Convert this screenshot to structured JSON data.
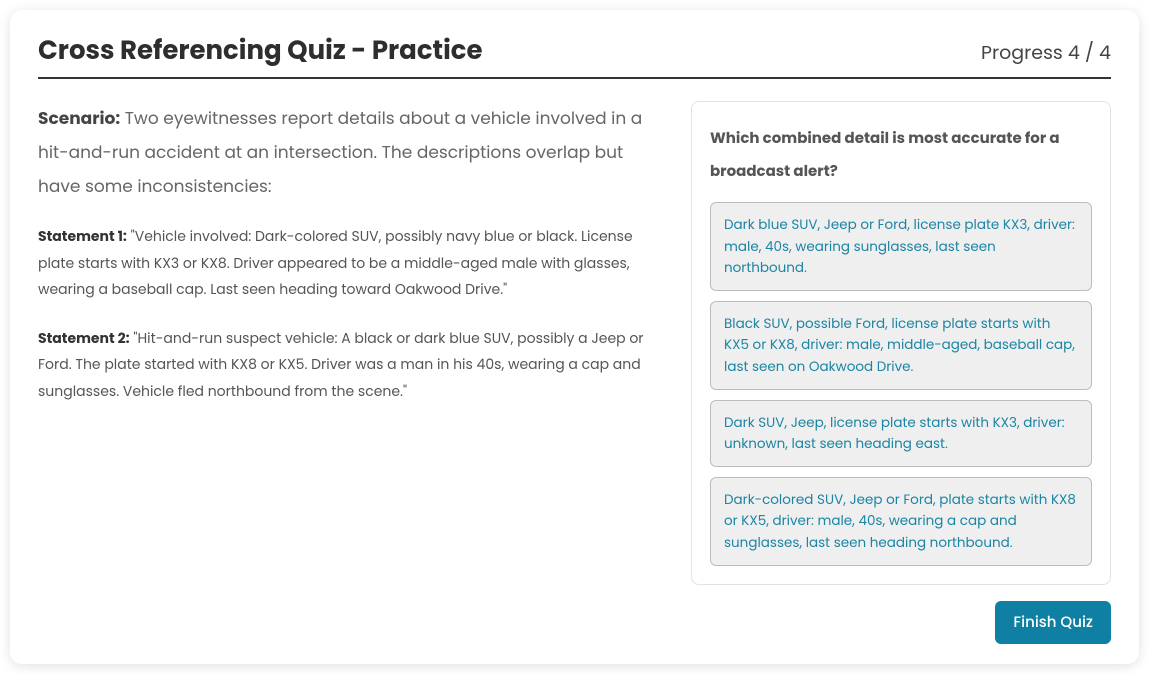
{
  "header": {
    "title": "Cross Referencing Quiz - Practice",
    "progress": "Progress 4 / 4"
  },
  "scenario": {
    "label": "Scenario:",
    "text": "Two eyewitnesses report details about a vehicle involved in a hit-and-run accident at an intersection. The descriptions overlap but have some inconsistencies:"
  },
  "statements": [
    {
      "label": "Statement 1:",
      "text": "\"Vehicle involved: Dark-colored SUV, possibly navy blue or black. License plate starts with KX3 or KX8. Driver appeared to be a middle-aged male with glasses, wearing a baseball cap. Last seen heading toward Oakwood Drive.\""
    },
    {
      "label": "Statement 2:",
      "text": "\"Hit-and-run suspect vehicle: A black or dark blue SUV, possibly a Jeep or Ford. The plate started with KX8 or KX5. Driver was a man in his 40s, wearing a cap and sunglasses. Vehicle fled northbound from the scene.\""
    }
  ],
  "question": "Which combined detail is most accurate for a broadcast alert?",
  "options": [
    "Dark blue SUV, Jeep or Ford, license plate KX3, driver: male, 40s, wearing sunglasses, last seen northbound.",
    "Black SUV, possible Ford, license plate starts with KX5 or KX8, driver: male, middle-aged, baseball cap, last seen on Oakwood Drive.",
    "Dark SUV, Jeep, license plate starts with KX3, driver: unknown, last seen heading east.",
    "Dark-colored SUV, Jeep or Ford, plate starts with KX8 or KX5, driver: male, 40s, wearing a cap and sunglasses, last seen heading northbound."
  ],
  "footer": {
    "finish": "Finish Quiz"
  }
}
